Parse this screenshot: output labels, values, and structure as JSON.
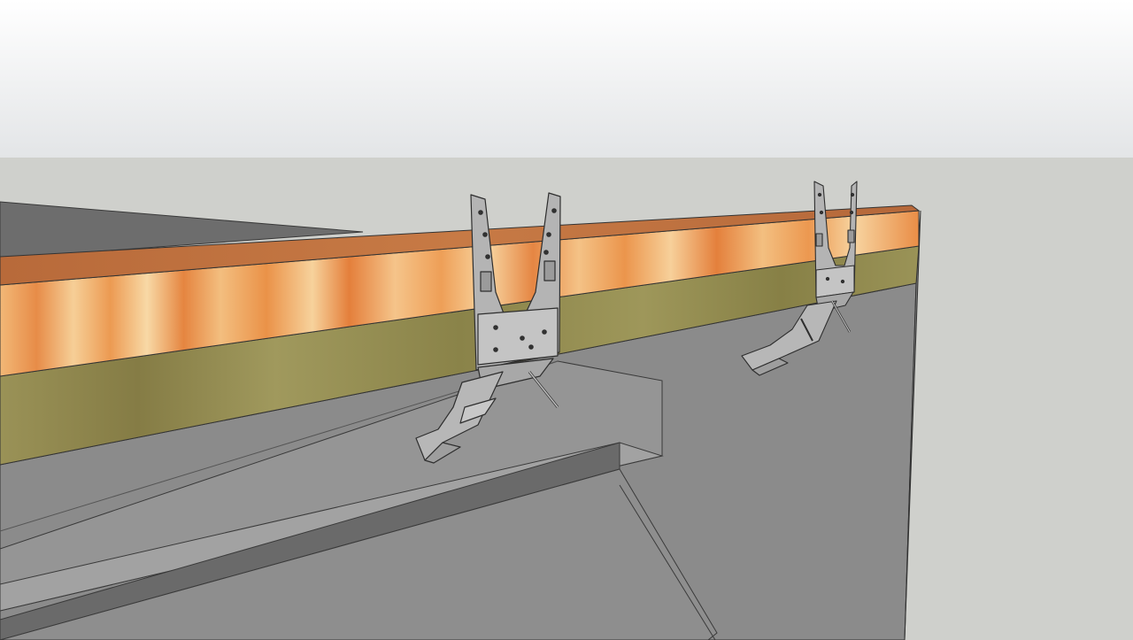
{
  "viewport": {
    "sky_colors": [
      "#ffffff",
      "#e3e5e7"
    ],
    "ground_color": "#cfd0cc"
  },
  "scene": {
    "objects": [
      {
        "name": "concrete-wall",
        "color": "#8a8a8a"
      },
      {
        "name": "timber-beam",
        "colors": [
          "#d98b45",
          "#f4c48a",
          "#e07a36"
        ]
      },
      {
        "name": "wooden-ledger",
        "color": "#8e864d"
      },
      {
        "name": "concrete-ledge",
        "color": "#9a9a9a"
      },
      {
        "name": "steel-bracket",
        "color": "#a9a9a9",
        "count": 2
      }
    ]
  }
}
